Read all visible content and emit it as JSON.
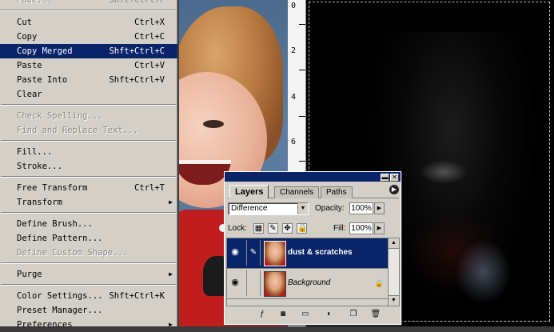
{
  "edit_menu": {
    "top_partial": {
      "label": "Fade...",
      "shortcut": "Shft+Ctrl+F"
    },
    "items": [
      {
        "label": "Cut",
        "shortcut": "Ctrl+X"
      },
      {
        "label": "Copy",
        "shortcut": "Ctrl+C"
      },
      {
        "label": "Copy Merged",
        "shortcut": "Shft+Ctrl+C"
      },
      {
        "label": "Paste",
        "shortcut": "Ctrl+V"
      },
      {
        "label": "Paste Into",
        "shortcut": "Shft+Ctrl+V"
      },
      {
        "label": "Clear",
        "shortcut": ""
      },
      {
        "label": "Check Spelling...",
        "shortcut": ""
      },
      {
        "label": "Find and Replace Text...",
        "shortcut": ""
      },
      {
        "label": "Fill...",
        "shortcut": ""
      },
      {
        "label": "Stroke...",
        "shortcut": ""
      },
      {
        "label": "Free Transform",
        "shortcut": "Ctrl+T"
      },
      {
        "label": "Transform",
        "shortcut": ""
      },
      {
        "label": "Define Brush...",
        "shortcut": ""
      },
      {
        "label": "Define Pattern...",
        "shortcut": ""
      },
      {
        "label": "Define Custom Shape...",
        "shortcut": ""
      },
      {
        "label": "Purge",
        "shortcut": ""
      },
      {
        "label": "Color Settings...",
        "shortcut": "Shft+Ctrl+K"
      },
      {
        "label": "Preset Manager...",
        "shortcut": ""
      },
      {
        "label": "Preferences",
        "shortcut": ""
      }
    ]
  },
  "ruler": {
    "ticks": [
      "0",
      "2",
      "4",
      "6"
    ]
  },
  "layers_palette": {
    "tabs": [
      "Layers",
      "Channels",
      "Paths"
    ],
    "blend_mode": "Difference",
    "opacity_label": "Opacity:",
    "opacity_value": "100%",
    "lock_label": "Lock:",
    "fill_label": "Fill:",
    "fill_value": "100%",
    "layers": [
      {
        "name": "dust & scratches",
        "selected": true
      },
      {
        "name": "Background",
        "selected": false
      }
    ],
    "title_buttons": [
      "minimize",
      "close"
    ]
  }
}
